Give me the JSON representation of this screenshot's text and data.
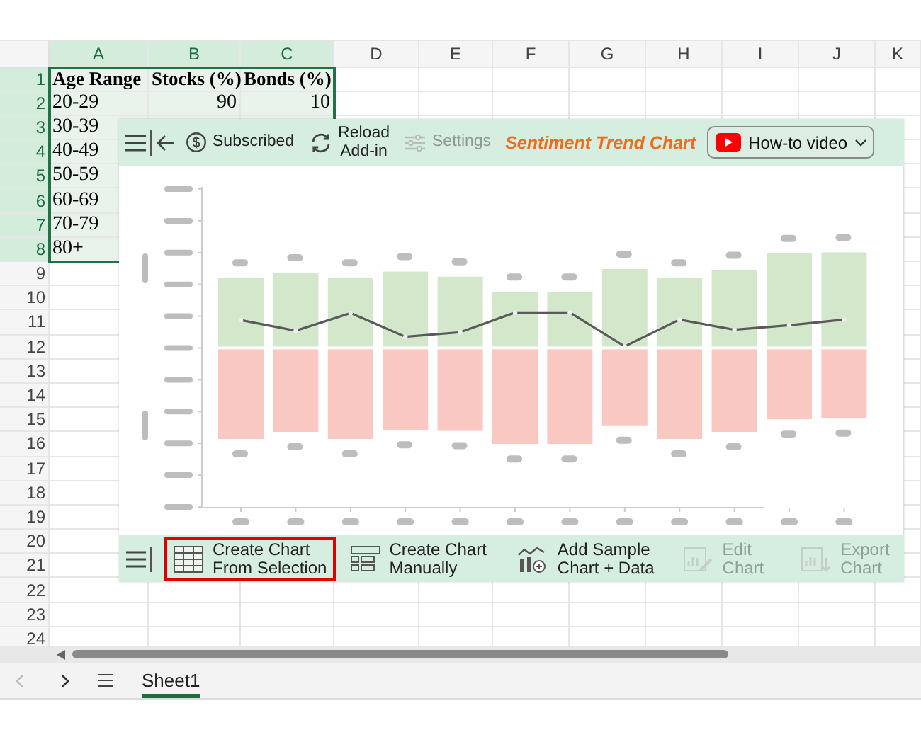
{
  "column_headers": [
    {
      "label": "A",
      "selected": true
    },
    {
      "label": "B",
      "selected": true
    },
    {
      "label": "C",
      "selected": true
    },
    {
      "label": "D",
      "selected": false
    },
    {
      "label": "E",
      "selected": false
    },
    {
      "label": "F",
      "selected": false
    },
    {
      "label": "G",
      "selected": false
    },
    {
      "label": "H",
      "selected": false
    },
    {
      "label": "I",
      "selected": false
    },
    {
      "label": "J",
      "selected": false
    },
    {
      "label": "K",
      "selected": false
    }
  ],
  "row_headers": [
    {
      "label": "1",
      "selected": true
    },
    {
      "label": "2",
      "selected": true
    },
    {
      "label": "3",
      "selected": true
    },
    {
      "label": "4",
      "selected": true
    },
    {
      "label": "5",
      "selected": true
    },
    {
      "label": "6",
      "selected": true
    },
    {
      "label": "7",
      "selected": true
    },
    {
      "label": "8",
      "selected": true
    },
    {
      "label": "9",
      "selected": false
    },
    {
      "label": "10",
      "selected": false
    },
    {
      "label": "11",
      "selected": false
    },
    {
      "label": "12",
      "selected": false
    },
    {
      "label": "13",
      "selected": false
    },
    {
      "label": "14",
      "selected": false
    },
    {
      "label": "15",
      "selected": false
    },
    {
      "label": "16",
      "selected": false
    },
    {
      "label": "17",
      "selected": false
    },
    {
      "label": "18",
      "selected": false
    },
    {
      "label": "19",
      "selected": false
    },
    {
      "label": "20",
      "selected": false
    },
    {
      "label": "21",
      "selected": false
    },
    {
      "label": "22",
      "selected": false
    },
    {
      "label": "23",
      "selected": false
    },
    {
      "label": "24",
      "selected": false
    }
  ],
  "rows": [
    [
      {
        "text": "Age Range",
        "kind": "heading"
      },
      {
        "text": "Stocks (%)",
        "kind": "heading"
      },
      {
        "text": "Bonds (%)",
        "kind": "heading"
      }
    ],
    [
      {
        "text": "20-29",
        "kind": "text"
      },
      {
        "text": "90",
        "kind": "number"
      },
      {
        "text": "10",
        "kind": "number"
      }
    ],
    [
      {
        "text": "30-39",
        "kind": "text"
      }
    ],
    [
      {
        "text": "40-49",
        "kind": "text"
      }
    ],
    [
      {
        "text": "50-59",
        "kind": "text"
      }
    ],
    [
      {
        "text": "60-69",
        "kind": "text"
      }
    ],
    [
      {
        "text": "70-79",
        "kind": "text"
      }
    ],
    [
      {
        "text": "80+",
        "kind": "text"
      }
    ]
  ],
  "addin": {
    "toolbar": [
      {
        "label": "Subscribed",
        "disabled": false
      },
      {
        "label": "Reload\nAdd-in",
        "disabled": false
      },
      {
        "label": "Settings",
        "disabled": true
      }
    ],
    "title": "Sentiment Trend Chart",
    "video_button": "How-to video",
    "actions": [
      {
        "label": "Create Chart\nFrom Selection",
        "disabled": false,
        "selected": true
      },
      {
        "label": "Create Chart\nManually",
        "disabled": false,
        "selected": false
      },
      {
        "label": "Add Sample\nChart + Data",
        "disabled": false,
        "selected": false
      },
      {
        "label": "Edit\nChart",
        "disabled": true,
        "selected": false
      },
      {
        "label": "Export\nChart",
        "disabled": true,
        "selected": false
      }
    ]
  },
  "sheet_tabs": [
    {
      "label": "Sheet1",
      "selected": true
    }
  ]
}
